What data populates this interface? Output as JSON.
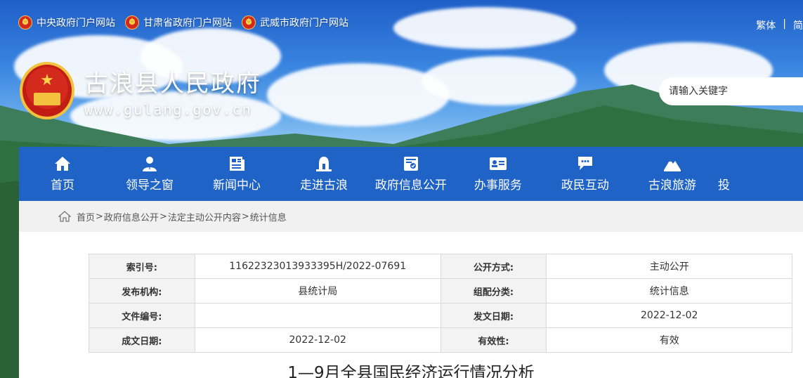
{
  "top_links": [
    {
      "label": "中央政府门户网站"
    },
    {
      "label": "甘肃省政府门户网站"
    },
    {
      "label": "武威市政府门户网站"
    }
  ],
  "lang": {
    "traditional": "繁体",
    "separator": "|",
    "simplified": "简"
  },
  "logo": {
    "title": "古浪县人民政府",
    "url": "www.gulang.gov.cn"
  },
  "search": {
    "placeholder": "请输入关键字"
  },
  "nav": [
    {
      "label": "首页",
      "icon": "home-icon"
    },
    {
      "label": "领导之窗",
      "icon": "leader-icon"
    },
    {
      "label": "新闻中心",
      "icon": "news-icon"
    },
    {
      "label": "走进古浪",
      "icon": "landmark-icon"
    },
    {
      "label": "政府信息公开",
      "icon": "info-disclosure-icon"
    },
    {
      "label": "办事服务",
      "icon": "service-card-icon"
    },
    {
      "label": "政民互动",
      "icon": "chat-icon"
    },
    {
      "label": "古浪旅游",
      "icon": "mountain-icon"
    },
    {
      "label": "投",
      "icon": ""
    }
  ],
  "breadcrumb": [
    "首页",
    "政府信息公开",
    "法定主动公开内容",
    "统计信息"
  ],
  "breadcrumb_sep": ">",
  "meta": {
    "index_label": "索引号:",
    "index_value": "11622323013933395H/2022-07691",
    "publish_mode_label": "公开方式:",
    "publish_mode_value": "主动公开",
    "org_label": "发布机构:",
    "org_value": "县统计局",
    "category_label": "组配分类:",
    "category_value": "统计信息",
    "doc_no_label": "文件编号:",
    "doc_no_value": "",
    "issue_date_label": "发文日期:",
    "issue_date_value": "2022-12-02",
    "created_date_label": "成文日期:",
    "created_date_value": "2022-12-02",
    "validity_label": "有效性:",
    "validity_value": "有效"
  },
  "article": {
    "title": "1—9月全县国民经济运行情况分析"
  }
}
